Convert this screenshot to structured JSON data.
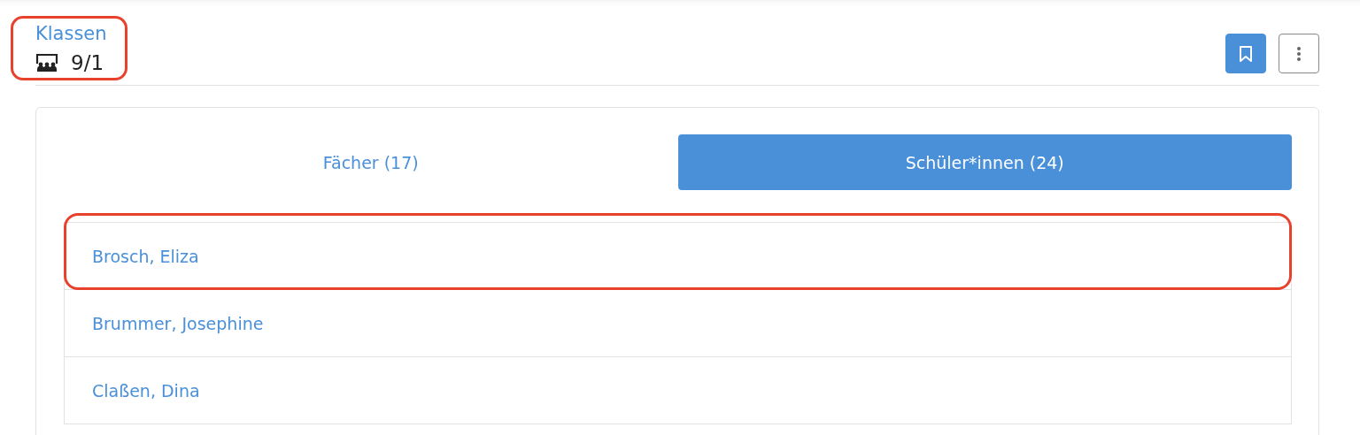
{
  "header": {
    "link": "Klassen",
    "class_name": "9/1",
    "highlighted": true
  },
  "actions": {
    "bookmark": {
      "active": true
    }
  },
  "tabs": [
    {
      "label": "Fächer (17)",
      "selected": false
    },
    {
      "label": "Schüler*innen (24)",
      "selected": true
    }
  ],
  "students": [
    {
      "name": "Brosch, Eliza",
      "highlighted": true
    },
    {
      "name": "Brummer, Josephine",
      "highlighted": false
    },
    {
      "name": "Claßen, Dina",
      "highlighted": false
    }
  ]
}
